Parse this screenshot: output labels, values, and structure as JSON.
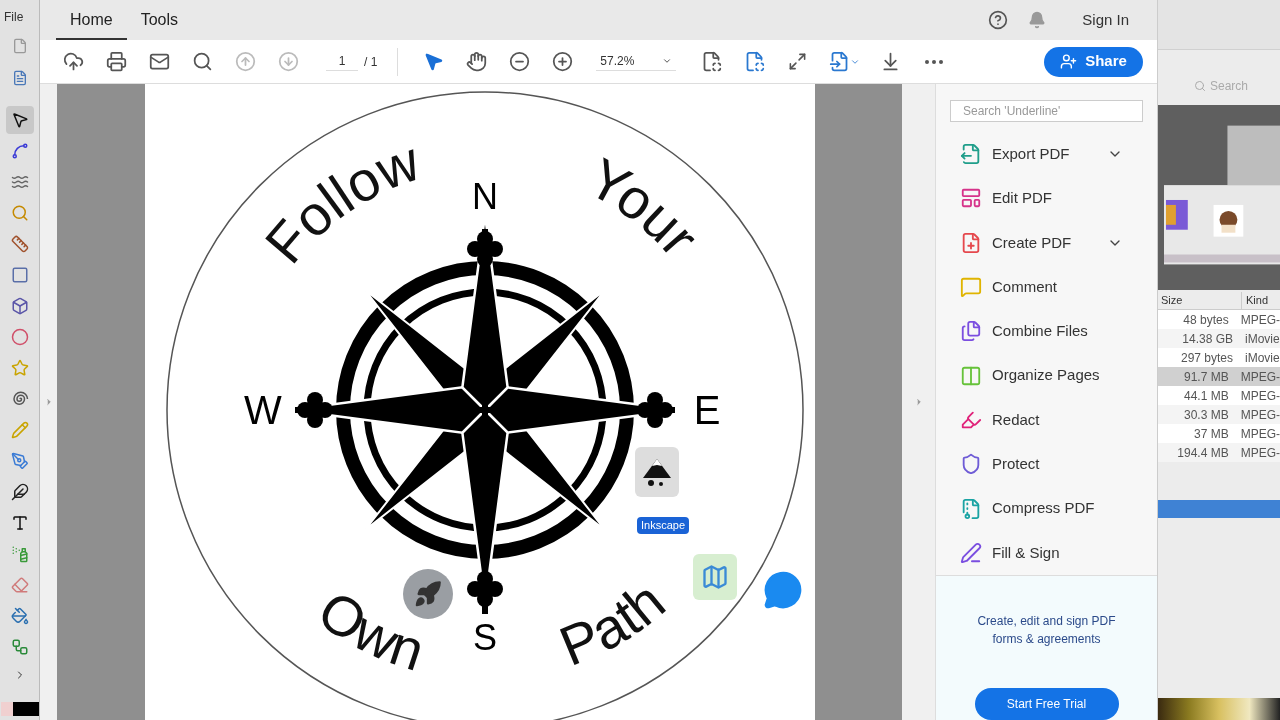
{
  "inkscape": {
    "menu": "File",
    "tools": [
      {
        "kind": "select",
        "selected": true
      },
      {
        "kind": "node",
        "selected": false
      },
      {
        "kind": "tweak",
        "selected": false
      },
      {
        "kind": "zoom",
        "selected": false
      },
      {
        "kind": "measure",
        "selected": false
      },
      {
        "kind": "rect",
        "selected": false
      },
      {
        "kind": "box",
        "selected": false
      },
      {
        "kind": "ellipse",
        "selected": false
      },
      {
        "kind": "star",
        "selected": false
      },
      {
        "kind": "spiral",
        "selected": false
      },
      {
        "kind": "pencil",
        "selected": false
      },
      {
        "kind": "pen",
        "selected": false
      },
      {
        "kind": "calligraphy",
        "selected": false
      },
      {
        "kind": "text",
        "selected": false
      },
      {
        "kind": "spray",
        "selected": false
      },
      {
        "kind": "eraser",
        "selected": false
      },
      {
        "kind": "bucket",
        "selected": false
      },
      {
        "kind": "connector",
        "selected": false
      }
    ]
  },
  "acrobat": {
    "tabs": [
      {
        "label": "Home",
        "selected": true
      },
      {
        "label": "Tools",
        "selected": false
      }
    ],
    "sign_in": "Sign In",
    "toolbar": {
      "buttons": [
        {
          "kind": "upload",
          "disabled": false
        },
        {
          "kind": "print",
          "disabled": false
        },
        {
          "kind": "email",
          "disabled": false
        },
        {
          "kind": "find",
          "disabled": false
        },
        {
          "kind": "previous",
          "disabled": true
        },
        {
          "kind": "next",
          "disabled": true
        }
      ],
      "page": "1",
      "total": "/ 1",
      "pointers": [
        {
          "kind": "select",
          "selected": true
        },
        {
          "kind": "hand",
          "selected": false
        }
      ],
      "zoom": "57.2%",
      "share": "Share"
    },
    "document": {
      "top_words": [
        "Follow",
        "Your"
      ],
      "bottom_words": [
        "Own",
        "Path"
      ],
      "north": "N",
      "west": "W",
      "east": "E",
      "south": "S"
    },
    "overlay": {
      "app_label": "Inkscape"
    },
    "panel": {
      "search_placeholder": "Search 'Underline'",
      "tools": [
        {
          "label": "Export PDF",
          "expandable": true,
          "color": "#1f9e8a"
        },
        {
          "label": "Edit PDF",
          "expandable": false,
          "color": "#d6338a"
        },
        {
          "label": "Create PDF",
          "expandable": true,
          "color": "#e5484d"
        },
        {
          "label": "Comment",
          "expandable": false,
          "color": "#e0b400"
        },
        {
          "label": "Combine Files",
          "expandable": false,
          "color": "#7b4ee0"
        },
        {
          "label": "Organize Pages",
          "expandable": false,
          "color": "#66c23a"
        },
        {
          "label": "Redact",
          "expandable": false,
          "color": "#e0237a"
        },
        {
          "label": "Protect",
          "expandable": false,
          "color": "#6e5bd6"
        },
        {
          "label": "Compress PDF",
          "expandable": false,
          "color": "#1aa3a3"
        },
        {
          "label": "Fill & Sign",
          "expandable": false,
          "color": "#7a4ee0"
        }
      ],
      "promo": "Create, edit and sign PDF forms & agreements",
      "trial": "Start Free Trial"
    }
  },
  "finder": {
    "search_placeholder": "Search",
    "columns": [
      "Size",
      "Kind"
    ],
    "rows": [
      {
        "size": "48 bytes",
        "kind": "MPEG-",
        "selected": false
      },
      {
        "size": "14.38 GB",
        "kind": "iMovie",
        "selected": false
      },
      {
        "size": "297 bytes",
        "kind": "iMovie",
        "selected": false
      },
      {
        "size": "91.7 MB",
        "kind": "MPEG-",
        "selected": true
      },
      {
        "size": "44.1 MB",
        "kind": "MPEG-",
        "selected": false
      },
      {
        "size": "30.3 MB",
        "kind": "MPEG-",
        "selected": false
      },
      {
        "size": "37 MB",
        "kind": "MPEG-",
        "selected": false
      },
      {
        "size": "194.4 MB",
        "kind": "MPEG-",
        "selected": false
      }
    ]
  }
}
